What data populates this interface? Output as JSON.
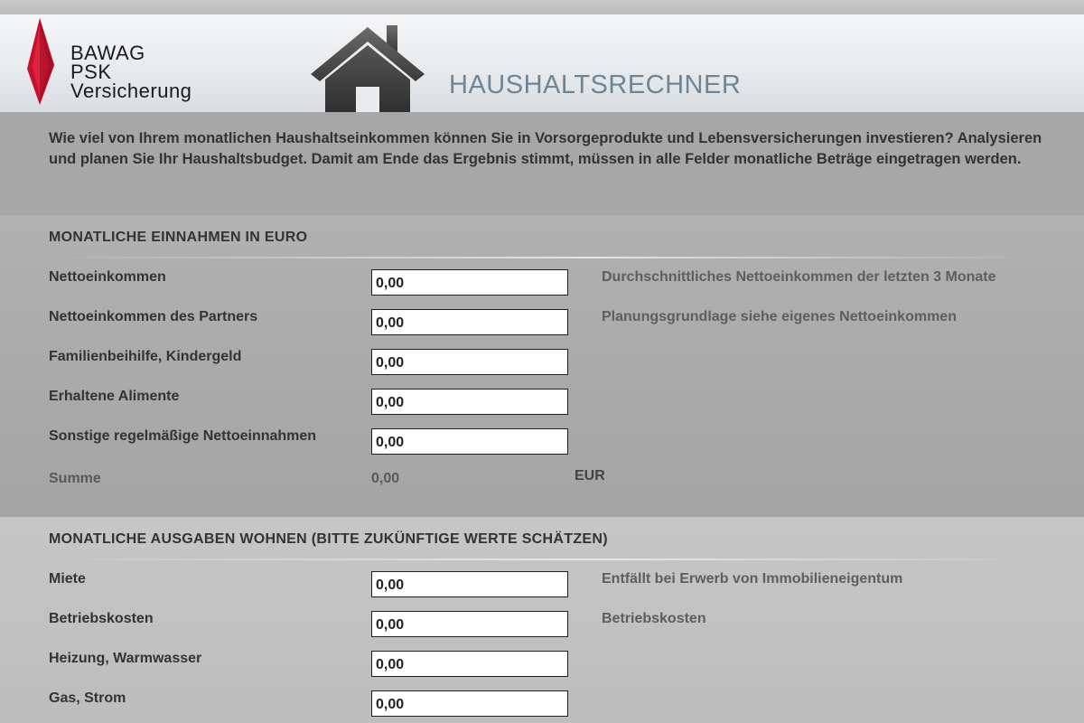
{
  "header": {
    "logo_lines": [
      "BAWAG",
      "PSK",
      "Versicherung"
    ],
    "app_title": "HAUSHALTSRECHNER"
  },
  "intro": {
    "text": "Wie viel von Ihrem monatlichen Haushaltseinkommen können Sie in Vorsorgeprodukte und Lebensversicherungen investieren? Analysieren und planen Sie Ihr Haushaltsbudget. Damit am Ende das Ergebnis stimmt, müssen in alle Felder monatliche Beträge eingetragen werden."
  },
  "income": {
    "title": "MONATLICHE EINNAHMEN IN EURO",
    "rows": [
      {
        "label": "Nettoeinkommen",
        "value": "0,00",
        "hint": "Durchschnittliches Nettoeinkommen der letzten 3 Monate"
      },
      {
        "label": "Nettoeinkommen des Partners",
        "value": "0,00",
        "hint": "Planungsgrundlage siehe eigenes Nettoeinkommen"
      },
      {
        "label": "Familienbeihilfe, Kindergeld",
        "value": "0,00",
        "hint": ""
      },
      {
        "label": "Erhaltene Alimente",
        "value": "0,00",
        "hint": ""
      },
      {
        "label": "Sonstige regelmäßige Nettoeinnahmen",
        "value": "0,00",
        "hint": ""
      }
    ],
    "sum_label": "Summe",
    "sum_value": "0,00",
    "sum_unit": "EUR"
  },
  "expenses": {
    "title": "MONATLICHE AUSGABEN WOHNEN (BITTE ZUKÜNFTIGE WERTE SCHÄTZEN)",
    "rows": [
      {
        "label": "Miete",
        "value": "0,00",
        "hint": "Entfällt bei Erwerb von Immobilieneigentum"
      },
      {
        "label": "Betriebskosten",
        "value": "0,00",
        "hint": "Betriebskosten"
      },
      {
        "label": "Heizung, Warmwasser",
        "value": "0,00",
        "hint": ""
      },
      {
        "label": "Gas, Strom",
        "value": "0,00",
        "hint": ""
      }
    ]
  },
  "colors": {
    "logo_red": "#c8102e",
    "title_blue": "#6e8596",
    "text_dark": "#333333",
    "hint_gray": "#5e5e5e"
  },
  "icons": {
    "logo": "bawag-diamond-logo-icon",
    "house": "house-icon"
  }
}
